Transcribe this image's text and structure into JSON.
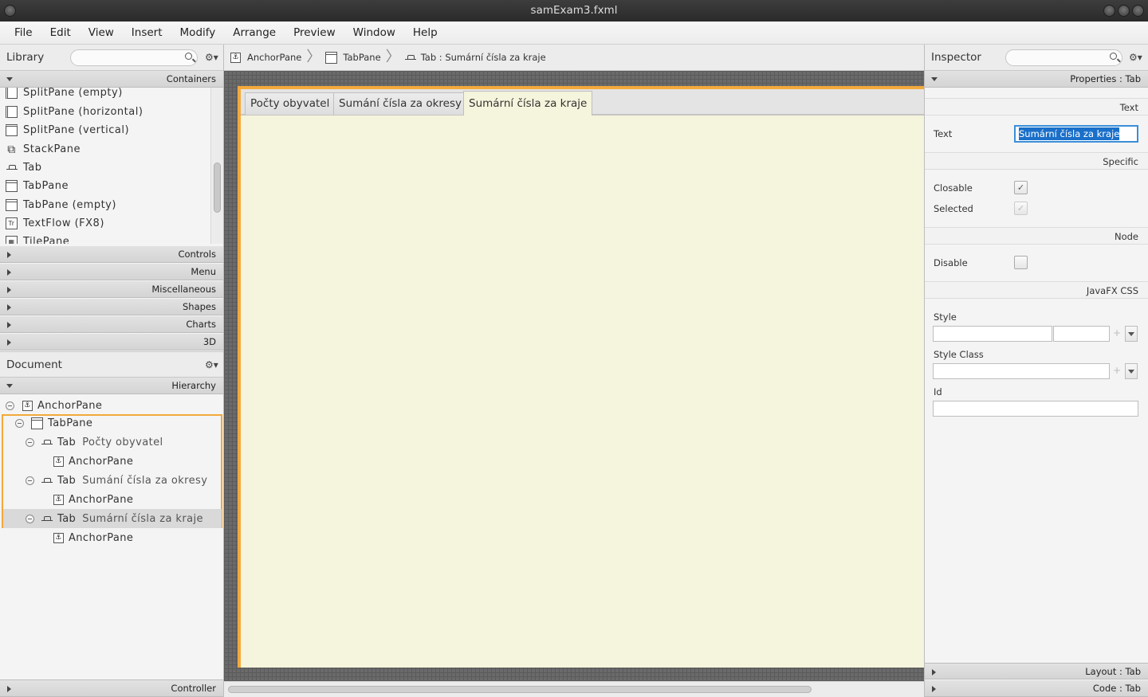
{
  "window": {
    "title": "samExam3.fxml"
  },
  "menu": [
    "File",
    "Edit",
    "View",
    "Insert",
    "Modify",
    "Arrange",
    "Preview",
    "Window",
    "Help"
  ],
  "library": {
    "title": "Library",
    "search_placeholder": "",
    "gear": "⚙▾",
    "sections": [
      "Containers",
      "Controls",
      "Menu",
      "Miscellaneous",
      "Shapes",
      "Charts",
      "3D"
    ],
    "items": [
      {
        "label": "SplitPane  (empty)",
        "icon": "splitpane-icon"
      },
      {
        "label": "SplitPane  (horizontal)",
        "icon": "splitpane-horizontal-icon"
      },
      {
        "label": "SplitPane  (vertical)",
        "icon": "splitpane-vertical-icon"
      },
      {
        "label": "StackPane",
        "icon": "stackpane-icon"
      },
      {
        "label": "Tab",
        "icon": "tab-icon"
      },
      {
        "label": "TabPane",
        "icon": "tabpane-icon"
      },
      {
        "label": "TabPane  (empty)",
        "icon": "tabpane-icon"
      },
      {
        "label": "TextFlow  (FX8)",
        "icon": "textflow-icon"
      },
      {
        "label": "TilePane",
        "icon": "tilepane-icon"
      }
    ]
  },
  "document": {
    "title": "Document",
    "gear": "⚙▾",
    "section": "Hierarchy",
    "tree": [
      {
        "type": "AnchorPane",
        "name": ""
      },
      {
        "type": "TabPane",
        "name": ""
      },
      {
        "type": "Tab",
        "name": "Počty obyvatel"
      },
      {
        "type": "AnchorPane",
        "name": ""
      },
      {
        "type": "Tab",
        "name": "Sumání čísla za okresy"
      },
      {
        "type": "AnchorPane",
        "name": ""
      },
      {
        "type": "Tab",
        "name": "Sumární čísla za kraje"
      },
      {
        "type": "AnchorPane",
        "name": ""
      }
    ],
    "controller": "Controller"
  },
  "breadcrumb": {
    "items": [
      "AnchorPane",
      "TabPane",
      "Tab :  Sumární čísla za kraje"
    ]
  },
  "canvas": {
    "tabs": [
      "Počty obyvatel",
      "Sumání čísla za okresy",
      "Sumární čísla za kraje"
    ],
    "selected_tab": 2,
    "content_color": "#f5f4dc"
  },
  "inspector": {
    "title": "Inspector",
    "gear": "⚙▾",
    "section": "Properties : Tab",
    "categories": {
      "text": "Text",
      "specific": "Specific",
      "node": "Node",
      "css": "JavaFX CSS"
    },
    "text_label": "Text",
    "text_value": "Sumární čísla za kraje",
    "closable_label": "Closable",
    "closable_mark": "✓",
    "selected_label": "Selected",
    "selected_mark": "✓",
    "disable_label": "Disable",
    "style_label": "Style",
    "style_class_label": "Style Class",
    "id_label": "Id",
    "plus": "+",
    "layout_section": "Layout : Tab",
    "code_section": "Code : Tab"
  },
  "colors": {
    "selection": "#f2a93b",
    "accent_blue": "#1a6fc9"
  }
}
